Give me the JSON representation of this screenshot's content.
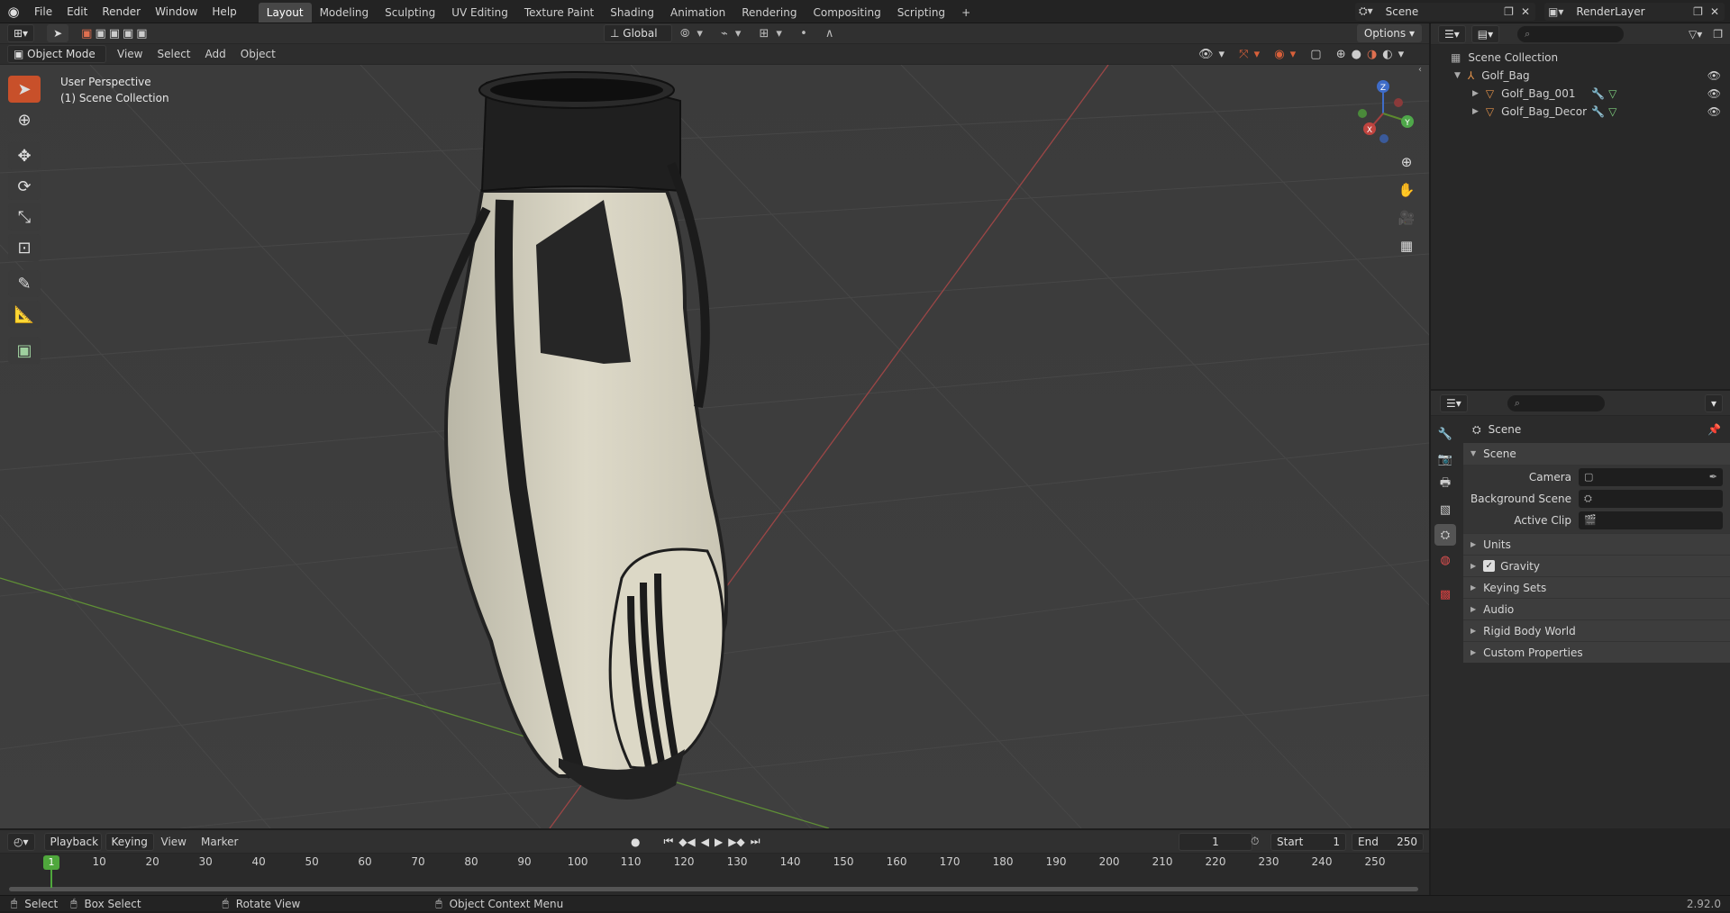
{
  "topbar": {
    "menus": [
      "File",
      "Edit",
      "Render",
      "Window",
      "Help"
    ],
    "workspaces": [
      "Layout",
      "Modeling",
      "Sculpting",
      "UV Editing",
      "Texture Paint",
      "Shading",
      "Animation",
      "Rendering",
      "Compositing",
      "Scripting"
    ],
    "active_workspace": "Layout",
    "add_workspace": "+",
    "scene_name": "Scene",
    "render_layer": "RenderLayer"
  },
  "viewport_header": {
    "mode": "Object Mode",
    "menus": [
      "View",
      "Select",
      "Add",
      "Object"
    ],
    "transform_orientation": "Global",
    "options_label": "Options"
  },
  "viewport": {
    "perspective_label": "User Perspective",
    "collection_label": "(1) Scene Collection",
    "gizmo": {
      "z": "Z",
      "y": "Y",
      "x": "X"
    },
    "colors": {
      "x_axis": "#a33f3f",
      "y_axis": "#5c8a2e",
      "z_axis": "#3f6cc8",
      "active_tool": "#c8502a"
    }
  },
  "tools": [
    "select-box",
    "cursor",
    "move",
    "rotate",
    "scale",
    "transform",
    "annotate",
    "measure",
    "add-cube"
  ],
  "outliner": {
    "root": "Scene Collection",
    "items": [
      {
        "name": "Golf_Bag",
        "level": 1
      },
      {
        "name": "Golf_Bag_001",
        "level": 2
      },
      {
        "name": "Golf_Bag_Decor",
        "level": 2
      }
    ]
  },
  "properties": {
    "context_title": "Scene",
    "panel_title": "Scene",
    "fields": [
      {
        "label": "Camera"
      },
      {
        "label": "Background Scene"
      },
      {
        "label": "Active Clip"
      }
    ],
    "subpanels": [
      "Units",
      "Gravity",
      "Keying Sets",
      "Audio",
      "Rigid Body World",
      "Custom Properties"
    ],
    "gravity_checked": true
  },
  "timeline": {
    "menus": [
      "Playback",
      "Keying",
      "View",
      "Marker"
    ],
    "current_frame": "1",
    "start_label": "Start",
    "start_value": "1",
    "end_label": "End",
    "end_value": "250",
    "ticks": [
      "10",
      "20",
      "30",
      "40",
      "50",
      "60",
      "70",
      "80",
      "90",
      "100",
      "110",
      "120",
      "130",
      "140",
      "150",
      "160",
      "170",
      "180",
      "190",
      "200",
      "210",
      "220",
      "230",
      "240",
      "250"
    ],
    "playhead_label": "1"
  },
  "statusbar": {
    "items": [
      "Select",
      "Box Select",
      "Rotate View",
      "Object Context Menu"
    ],
    "version": "2.92.0"
  }
}
